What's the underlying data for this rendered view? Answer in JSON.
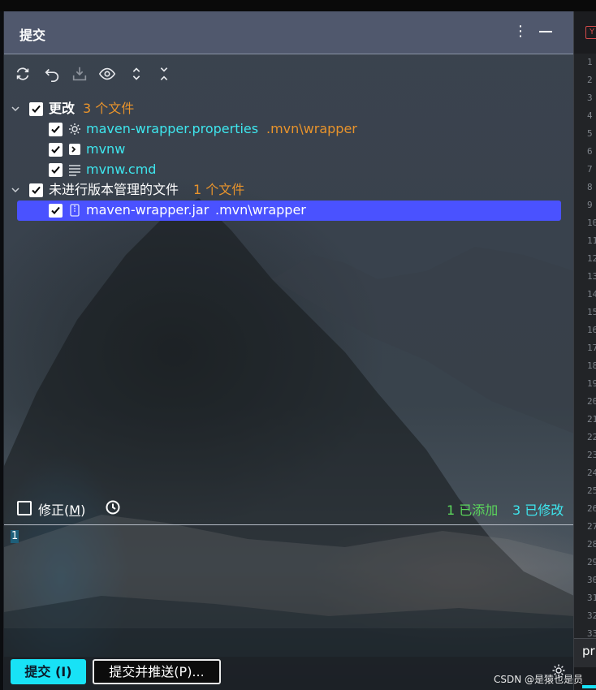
{
  "panel": {
    "title": "提交",
    "menu_icon": "vertical-dots-icon",
    "minimize_icon": "minimize-icon"
  },
  "toolbar": {
    "buttons": [
      "refresh-icon",
      "rollback-icon",
      "shelve-icon",
      "preview-icon",
      "expand-all-icon",
      "collapse-all-icon"
    ]
  },
  "tree": {
    "changes_group": {
      "label": "更改",
      "count": "3 个文件",
      "checked": true,
      "expanded": true
    },
    "changes": [
      {
        "name": "maven-wrapper.properties",
        "path": ".mvn\\wrapper",
        "icon": "settings-file-icon",
        "checked": true
      },
      {
        "name": "mvnw",
        "path": "",
        "icon": "shell-script-icon",
        "checked": true
      },
      {
        "name": "mvnw.cmd",
        "path": "",
        "icon": "text-file-icon",
        "checked": true
      }
    ],
    "unversioned_group": {
      "label": "未进行版本管理的文件",
      "count": "1 个文件",
      "checked": true,
      "expanded": true
    },
    "unversioned": [
      {
        "name": "maven-wrapper.jar",
        "path": ".mvn\\wrapper",
        "icon": "archive-file-icon",
        "checked": true,
        "selected": true
      }
    ]
  },
  "amend": {
    "label_prefix": "修正(",
    "mnemonic": "M",
    "label_suffix": ")",
    "checked": false,
    "history_icon": "clock-icon"
  },
  "stats": {
    "added": "1 已添加",
    "modified": "3 已修改"
  },
  "message": {
    "line_number": "1",
    "text": ""
  },
  "buttons": {
    "commit": "提交 (I)",
    "commit_push": "提交并推送(P)...",
    "settings_icon": "gear-icon"
  },
  "editor": {
    "tab_icon": "Y",
    "line_numbers": [
      "1",
      "2",
      "3",
      "4",
      "5",
      "6",
      "7",
      "8",
      "9",
      "10",
      "11",
      "12",
      "13",
      "14",
      "15",
      "16",
      "17",
      "18",
      "19",
      "20",
      "21",
      "22",
      "23",
      "24",
      "25",
      "26",
      "27",
      "28",
      "29",
      "30",
      "31",
      "32",
      "33"
    ],
    "footer_text": "pr"
  },
  "watermark": "CSDN @是猿也是员"
}
